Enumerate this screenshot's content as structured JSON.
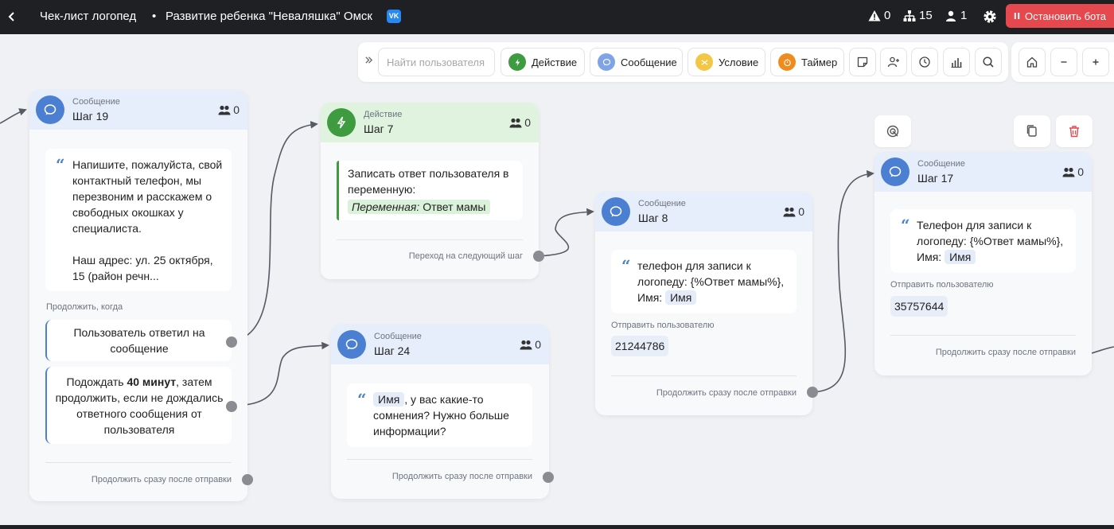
{
  "topbar": {
    "title": "Чек-лист логопед",
    "separator": "•",
    "bot_name": "Развитие ребенка \"Неваляшка\" Омск",
    "vk_label": "VK",
    "warnings_count": "0",
    "structure_count": "15",
    "users_count": "1",
    "stop_button": "Остановить бота"
  },
  "toolbar": {
    "search_placeholder": "Найти пользователя",
    "buttons": {
      "action": "Действие",
      "message": "Сообщение",
      "condition": "Условие",
      "timer": "Таймер"
    },
    "colors": {
      "action": "#3f9b3f",
      "message": "#7ea3e6",
      "condition": "#f3c744",
      "timer": "#f08c1e"
    }
  },
  "cards": {
    "step19": {
      "type": "Сообщение",
      "step": "Шаг 19",
      "users": "0",
      "text": "Напишите, пожалуйста, свой контактный телефон, мы перезвоним и расскажем о свободных окошках у специалиста.",
      "text2": "Наш адрес: ул. 25 октября, 15 (район речн...",
      "continue_when": "Продолжить, когда",
      "cond1": "Пользователь ответил на сообщение",
      "cond2_prefix": "Подождать ",
      "cond2_bold": "40 минут",
      "cond2_suffix": ", затем продолжить, если не дождались ответного сообщения от пользователя",
      "footer": "Продолжить сразу после отправки"
    },
    "step7": {
      "type": "Действие",
      "step": "Шаг 7",
      "users": "0",
      "text": "Записать ответ пользователя в переменную:",
      "var_label": "Переменная:",
      "var_value": "Ответ мамы",
      "footer": "Переход на следующий шаг"
    },
    "step24": {
      "type": "Сообщение",
      "step": "Шаг 24",
      "users": "0",
      "tag": "Имя",
      "text": ", у вас какие-то сомнения? Нужно больше информации?",
      "footer": "Продолжить сразу после отправки"
    },
    "step8": {
      "type": "Сообщение",
      "step": "Шаг 8",
      "users": "0",
      "text": "телефон для записи к логопеду: {%Ответ мамы%}, Имя:",
      "tag": "Имя",
      "send_to": "Отправить пользователю",
      "recipient": "21244786",
      "footer": "Продолжить сразу после отправки"
    },
    "step17": {
      "type": "Сообщение",
      "step": "Шаг 17",
      "users": "0",
      "text": "Телефон для записи к логопеду: {%Ответ мамы%}, Имя:",
      "tag": "Имя",
      "send_to": "Отправить пользователю",
      "recipient": "35757644",
      "footer": "Продолжить сразу после отправки"
    }
  }
}
